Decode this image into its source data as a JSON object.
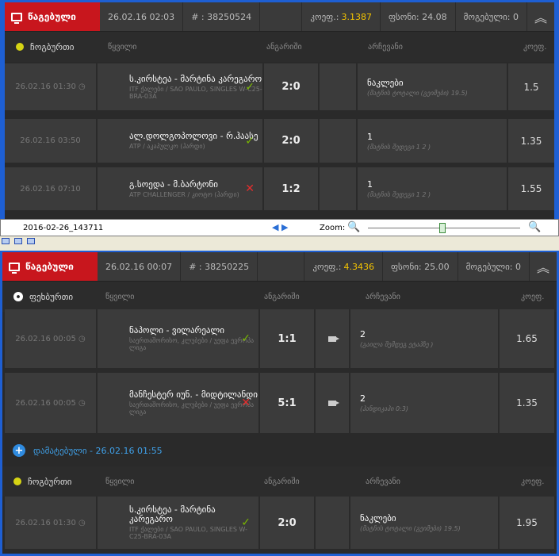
{
  "ticket1": {
    "lost_label": "წაგებული",
    "datetime": "26.02.16 02:03",
    "ticket_no": "# : 38250524",
    "odds_label": "კოეფ.:",
    "odds_value": "3.1387",
    "stake": "ფსონი: 24.08",
    "won": "მოგებული: 0",
    "sport": "ჩოგბურთი",
    "col_event": "წყვილი",
    "col_result": "ანგარიში",
    "col_choice": "არჩევანი",
    "col_odds": "კოეფ.",
    "rows": [
      {
        "date": "26.02.16 01:30 ◷",
        "teams": "ს.კირსტეა - მარტინა კარეგარო",
        "league": "ITF ქალები / SAO PAULO, SINGLES W-C25-BRA-03A",
        "mark": "✓",
        "score": "2:0",
        "choice": "ნაკლები",
        "choice_sub": "(მატჩის ტოტალი (გეიმები) 19.5)",
        "odds": "1.5"
      },
      {
        "date": "26.02.16 03:50",
        "teams": "ალ.დოლგოპოლოვი - რ.ჰაასე",
        "league": "ATP / აკაპულკო (ჰარდი)",
        "mark": "✓",
        "score": "2:0",
        "choice": "1",
        "choice_sub": "(მატჩის შედეგი 1 2 )",
        "odds": "1.35"
      },
      {
        "date": "26.02.16 07:10",
        "teams": "გ.სოედა - მ.ბარტონი",
        "league": "ATP CHALLENGER / კიოტო (ჰარდი)",
        "mark": "✕",
        "score": "1:2",
        "choice": "1",
        "choice_sub": "(მატჩის შედეგი 1 2 )",
        "odds": "1.55"
      }
    ]
  },
  "statusbar": {
    "filename": "2016-02-26_143711",
    "nav": "◀ ▶",
    "zoom_label": "Zoom:",
    "zoom_out": "🔍",
    "zoom_in": "🔍"
  },
  "ticket2": {
    "lost_label": "წაგებული",
    "datetime": "26.02.16 00:07",
    "ticket_no": "# : 38250225",
    "odds_label": "კოეფ.:",
    "odds_value": "4.3436",
    "stake": "ფსონი: 25.00",
    "won": "მოგებული: 0",
    "sport": "ფეხბურთი",
    "col_event": "წყვილი",
    "col_result": "ანგარიში",
    "col_choice": "არჩევანი",
    "col_odds": "კოეფ.",
    "rows": [
      {
        "date": "26.02.16 00:05 ◷",
        "teams": "ნაპოლი - ვილარეალი",
        "league": "საერთაშორისო, კლუბები / უეფა ევროპა ლიგა",
        "mark": "✓",
        "score": "1:1",
        "choice": "2",
        "choice_sub": "(გაილა შემდეგ ეტაპზე )",
        "odds": "1.65"
      },
      {
        "date": "26.02.16 00:05 ◷",
        "teams": "მანჩესტერ იუნ. - მიდტილანდი",
        "league": "საერთაშორისო, კლუბები / უეფა ევროპა ლიგა",
        "mark": "✕",
        "score": "5:1",
        "choice": "2",
        "choice_sub": "(ჰანდიკაპი 0:3)",
        "odds": "1.35"
      }
    ],
    "confirmed": "დამატებული - 26.02.16 01:55",
    "sport2": "ჩოგბურთი",
    "rows2": [
      {
        "date": "26.02.16 01:30 ◷",
        "teams": "ს.კირსტეა - მარტინა კარეგარო",
        "league": "ITF ქალები / SAO PAULO, SINGLES W-C25-BRA-03A",
        "mark": "✓",
        "score": "2:0",
        "choice": "ნაკლები",
        "choice_sub": "(მატჩის ტოტალი (გეიმები) 19.5)",
        "odds": "1.95"
      }
    ]
  },
  "colors": {
    "lost": "#c8161d",
    "win": "#7ab800",
    "loss": "#e52d2d",
    "accent": "#3fa0e8",
    "odds": "#f4c400"
  }
}
